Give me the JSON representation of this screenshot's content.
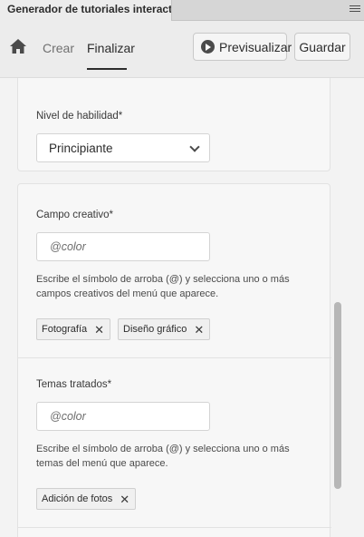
{
  "panel": {
    "title": "Generador de tutoriales interactivos",
    "menu_icon": "hamburger-icon"
  },
  "nav": {
    "home_icon": "home-icon",
    "tabs": [
      {
        "label": "Crear"
      },
      {
        "label": "Finalizar",
        "active": true
      }
    ]
  },
  "toolbar": {
    "preview_label": "Previsualizar",
    "preview_icon": "play-circle-icon",
    "save_label": "Guardar"
  },
  "skill": {
    "label": "Nivel de habilidad*",
    "value": "Principiante"
  },
  "creative": {
    "label": "Campo creativo*",
    "placeholder": "@color",
    "help": "Escribe el símbolo de arroba (@) y selecciona uno o más campos creativos del menú que aparece.",
    "chips": [
      "Fotografía",
      "Diseño gráfico"
    ]
  },
  "topics": {
    "label": "Temas tratados*",
    "placeholder": "@color",
    "help": "Escribe el símbolo de arroba (@) y selecciona uno o más temas del menú que aparece.",
    "chips": [
      "Adición de fotos"
    ]
  }
}
